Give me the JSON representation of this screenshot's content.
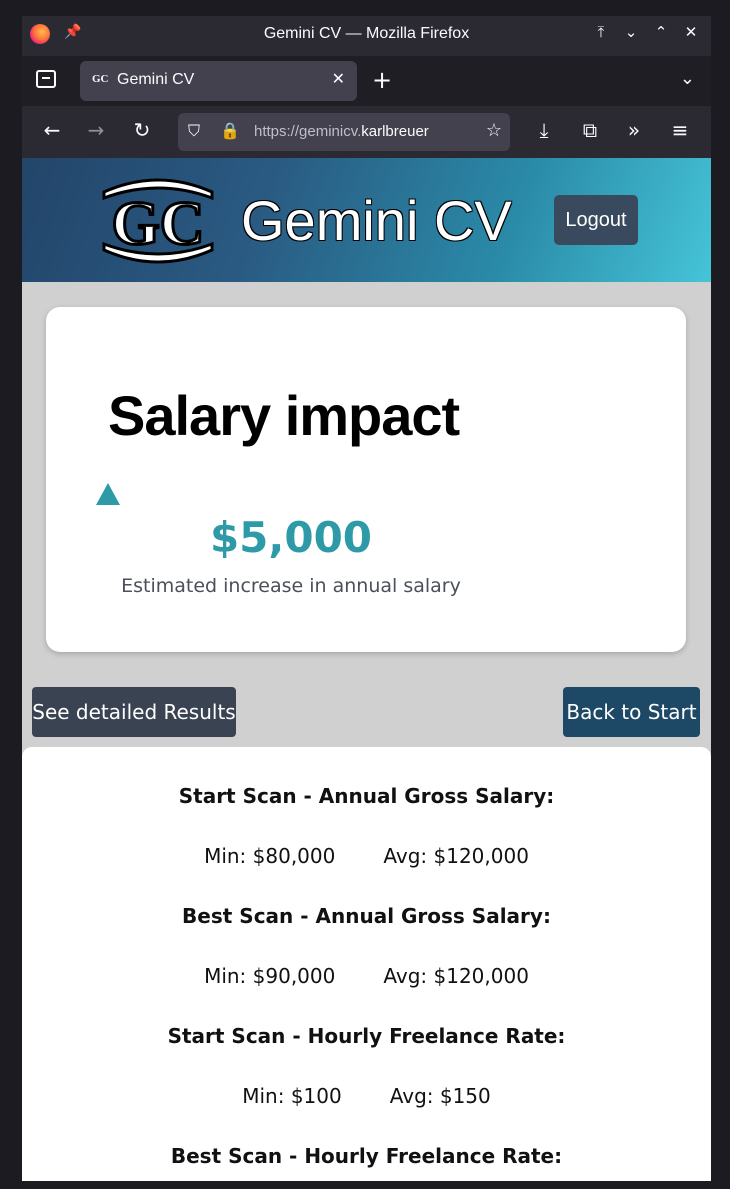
{
  "browser": {
    "window_title": "Gemini CV — Mozilla Firefox",
    "tab_title": "Gemini CV",
    "tab_favicon": "GC",
    "url_prefix": "https://geminicv.",
    "url_domain": "karlbreuer",
    "icons": [
      "firefox-logo",
      "pin-icon",
      "tab-overview-icon",
      "back-arrow-icon",
      "forward-arrow-icon",
      "reload-icon",
      "shield-icon",
      "lock-icon",
      "star-icon",
      "download-icon",
      "extensions-icon",
      "overflow-icon",
      "menu-icon"
    ]
  },
  "header": {
    "logo_text": "GC",
    "brand": "Gemini CV",
    "logout_label": "Logout",
    "gradient": [
      "#23456a",
      "#45c4d8"
    ]
  },
  "impact_card": {
    "title": "Salary impact",
    "amount": "$5,000",
    "caption": "Estimated increase in annual salary",
    "accent_color": "#2e9aa8",
    "trend_icon": "up-triangle-icon"
  },
  "actions": {
    "details_label": "See detailed Results",
    "back_label": "Back to Start"
  },
  "results": [
    {
      "heading": "Start Scan - Annual Gross Salary:",
      "min": "Min: $80,000",
      "avg": "Avg: $120,000"
    },
    {
      "heading": "Best Scan - Annual Gross Salary:",
      "min": "Min: $90,000",
      "avg": "Avg: $120,000"
    },
    {
      "heading": "Start Scan - Hourly Freelance Rate:",
      "min": "Min: $100",
      "avg": "Avg: $150"
    },
    {
      "heading": "Best Scan - Hourly Freelance Rate:"
    }
  ]
}
